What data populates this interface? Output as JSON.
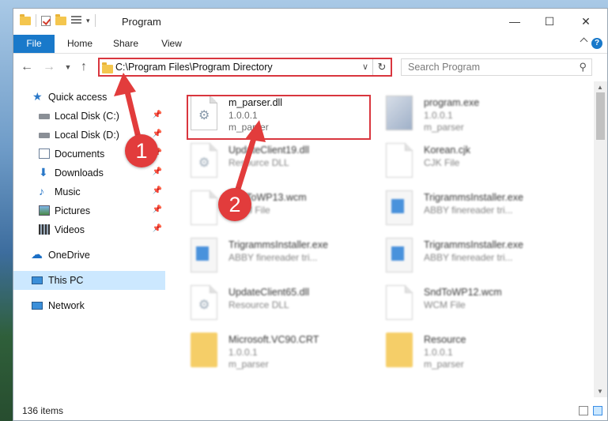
{
  "window": {
    "title": "Program"
  },
  "ribbon": {
    "tabs": [
      "File",
      "Home",
      "Share",
      "View"
    ]
  },
  "address": {
    "path": "C:\\Program Files\\Program Directory"
  },
  "search": {
    "placeholder": "Search Program"
  },
  "nav": {
    "items": [
      {
        "label": "Quick access",
        "icon": "star-icon",
        "pinned": false
      },
      {
        "label": "Local Disk (C:)",
        "icon": "drive-icon",
        "pinned": true
      },
      {
        "label": "Local Disk (D:)",
        "icon": "drive-icon",
        "pinned": true
      },
      {
        "label": "Documents",
        "icon": "documents-icon",
        "pinned": true
      },
      {
        "label": "Downloads",
        "icon": "downloads-icon",
        "pinned": true
      },
      {
        "label": "Music",
        "icon": "music-icon",
        "pinned": true
      },
      {
        "label": "Pictures",
        "icon": "pictures-icon",
        "pinned": true
      },
      {
        "label": "Videos",
        "icon": "videos-icon",
        "pinned": true
      },
      {
        "label": "OneDrive",
        "icon": "onedrive-icon",
        "pinned": false
      },
      {
        "label": "This PC",
        "icon": "this-pc-icon",
        "pinned": false,
        "selected": true
      },
      {
        "label": "Network",
        "icon": "network-icon",
        "pinned": false
      }
    ]
  },
  "files": [
    {
      "name": "m_parser.dll",
      "line2": "1.0.0.1",
      "line3": "m_parser",
      "icon": "dll-icon",
      "blurred": false
    },
    {
      "name": "program.exe",
      "line2": "1.0.0.1",
      "line3": "m_parser",
      "icon": "exe-icon",
      "blurred": true
    },
    {
      "name": "UpdateClient19.dll",
      "line2": "Resource DLL",
      "line3": "",
      "icon": "dll-icon",
      "blurred": true
    },
    {
      "name": "Korean.cjk",
      "line2": "CJK File",
      "line3": "",
      "icon": "document-icon",
      "blurred": true
    },
    {
      "name": "SndToWP13.wcm",
      "line2": "WCM File",
      "line3": "",
      "icon": "document-icon",
      "blurred": true
    },
    {
      "name": "TrigrammsInstaller.exe",
      "line2": "ABBY finereader tri...",
      "line3": "",
      "icon": "installer-icon",
      "blurred": true
    },
    {
      "name": "TrigrammsInstaller.exe",
      "line2": "ABBY finereader tri...",
      "line3": "",
      "icon": "installer-icon",
      "blurred": true
    },
    {
      "name": "TrigrammsInstaller.exe",
      "line2": "ABBY finereader tri...",
      "line3": "",
      "icon": "installer-icon",
      "blurred": true
    },
    {
      "name": "UpdateClient65.dll",
      "line2": "Resource DLL",
      "line3": "",
      "icon": "dll-icon",
      "blurred": true
    },
    {
      "name": "SndToWP12.wcm",
      "line2": "WCM File",
      "line3": "",
      "icon": "document-icon",
      "blurred": true
    },
    {
      "name": "Microsoft.VC90.CRT",
      "line2": "1.0.0.1",
      "line3": "m_parser",
      "icon": "folder-icon",
      "blurred": true
    },
    {
      "name": "Resource",
      "line2": "1.0.0.1",
      "line3": "m_parser",
      "icon": "folder-icon",
      "blurred": true
    }
  ],
  "status": {
    "count": "136 items"
  },
  "callouts": {
    "one": "1",
    "two": "2"
  },
  "colors": {
    "accent": "#1979ca",
    "callout": "#e23c3c",
    "selection": "#cce8ff"
  }
}
